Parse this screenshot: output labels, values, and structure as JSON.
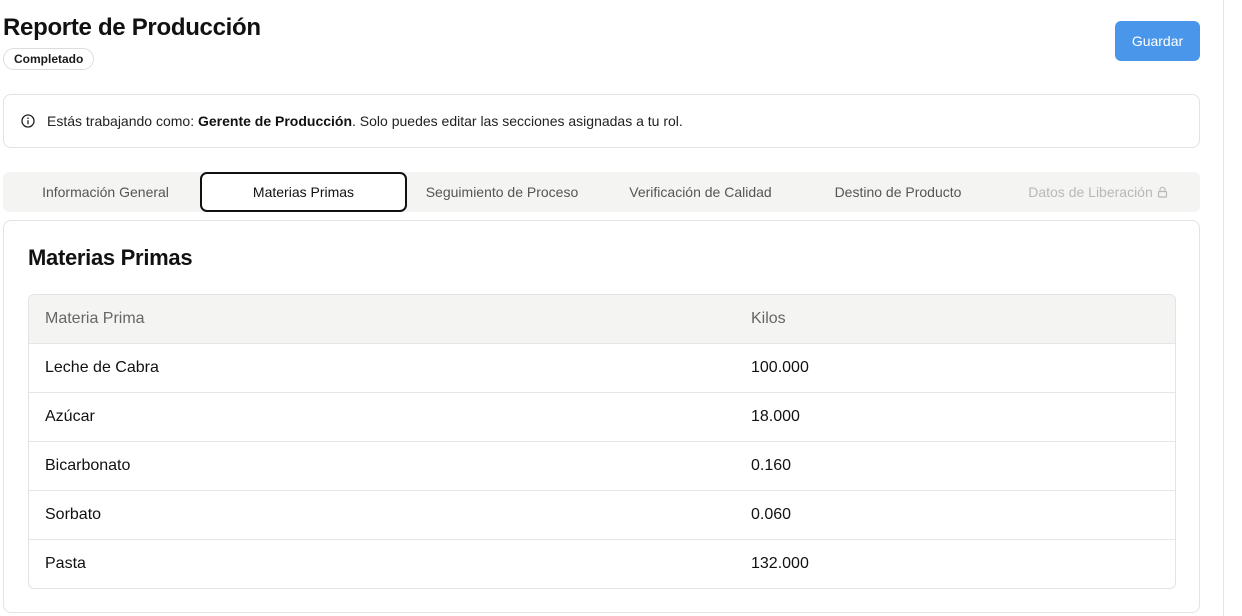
{
  "header": {
    "title": "Reporte de Producción",
    "status_badge": "Completado",
    "save_label": "Guardar"
  },
  "notice": {
    "prefix": "Estás trabajando como:",
    "role": "Gerente de Producción",
    "suffix": ". Solo puedes editar las secciones asignadas a tu rol."
  },
  "tabs": [
    {
      "label": "Información General",
      "active": false,
      "locked": false
    },
    {
      "label": "Materias Primas",
      "active": true,
      "locked": false
    },
    {
      "label": "Seguimiento de Proceso",
      "active": false,
      "locked": false
    },
    {
      "label": "Verificación de Calidad",
      "active": false,
      "locked": false
    },
    {
      "label": "Destino de Producto",
      "active": false,
      "locked": false
    },
    {
      "label": "Datos de Liberación",
      "active": false,
      "locked": true
    }
  ],
  "section": {
    "title": "Materias Primas",
    "columns": [
      "Materia Prima",
      "Kilos"
    ],
    "rows": [
      {
        "material": "Leche de Cabra",
        "kilos": "100.000"
      },
      {
        "material": "Azúcar",
        "kilos": "18.000"
      },
      {
        "material": "Bicarbonato",
        "kilos": "0.160"
      },
      {
        "material": "Sorbato",
        "kilos": "0.060"
      },
      {
        "material": "Pasta",
        "kilos": "132.000"
      }
    ]
  },
  "colors": {
    "accent": "#4a96ea",
    "tab_bar_bg": "#f4f4f3",
    "border": "#e3e3e3"
  }
}
